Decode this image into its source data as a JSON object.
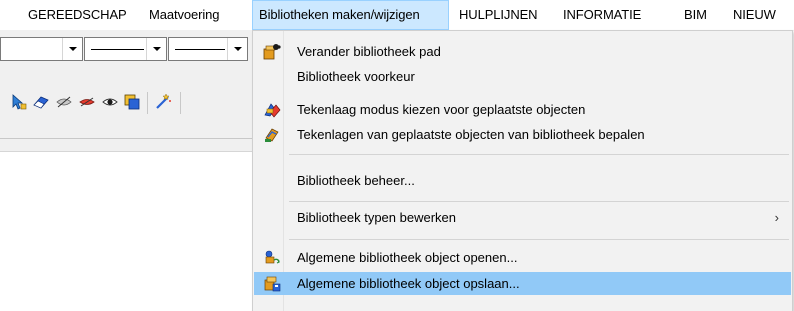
{
  "menubar": {
    "items": [
      "GEREEDSCHAP",
      "Maatvoering",
      "Bibliotheken maken/wijzigen",
      "HULPLIJNEN",
      "INFORMATIE",
      "BIM",
      "NIEUW"
    ],
    "active_index": 2
  },
  "toolbar": {
    "combo_icons": [
      "dropdown-arrow",
      "dropdown-arrow",
      "dropdown-arrow"
    ],
    "tool_icons": [
      "select-arrow-icon",
      "eraser-icon",
      "hide-icon",
      "hide-red-icon",
      "show-icon",
      "layer-copy-icon",
      "wand-icon"
    ]
  },
  "dropdown": {
    "items": [
      {
        "label": "Verander bibliotheek pad",
        "icon": "library-path-icon",
        "submenu": false,
        "highlighted": false
      },
      {
        "label": "Bibliotheek voorkeur",
        "icon": "",
        "submenu": false,
        "highlighted": false
      },
      {
        "label": "Tekenlaag modus kiezen voor geplaatste objecten",
        "icon": "layer-mode-icon",
        "submenu": false,
        "highlighted": false
      },
      {
        "label": "Tekenlagen van geplaatste objecten van bibliotheek bepalen",
        "icon": "layer-assign-icon",
        "submenu": false,
        "highlighted": false
      },
      {
        "label": "Bibliotheek beheer...",
        "icon": "",
        "submenu": false,
        "highlighted": false
      },
      {
        "label": "Bibliotheek typen bewerken",
        "icon": "",
        "submenu": true,
        "highlighted": false
      },
      {
        "label": "Algemene bibliotheek object openen...",
        "icon": "object-open-icon",
        "submenu": false,
        "highlighted": false
      },
      {
        "label": "Algemene bibliotheek object opslaan...",
        "icon": "object-save-icon",
        "submenu": false,
        "highlighted": true
      }
    ],
    "submenu_glyph": "›"
  },
  "colors": {
    "menubar_active_bg": "#cce8ff",
    "menubar_active_border": "#99d1ff",
    "dropdown_bg": "#f2f2f2",
    "highlight_bg": "#91c9f7",
    "toolbar_bg": "#f0f0f0"
  }
}
